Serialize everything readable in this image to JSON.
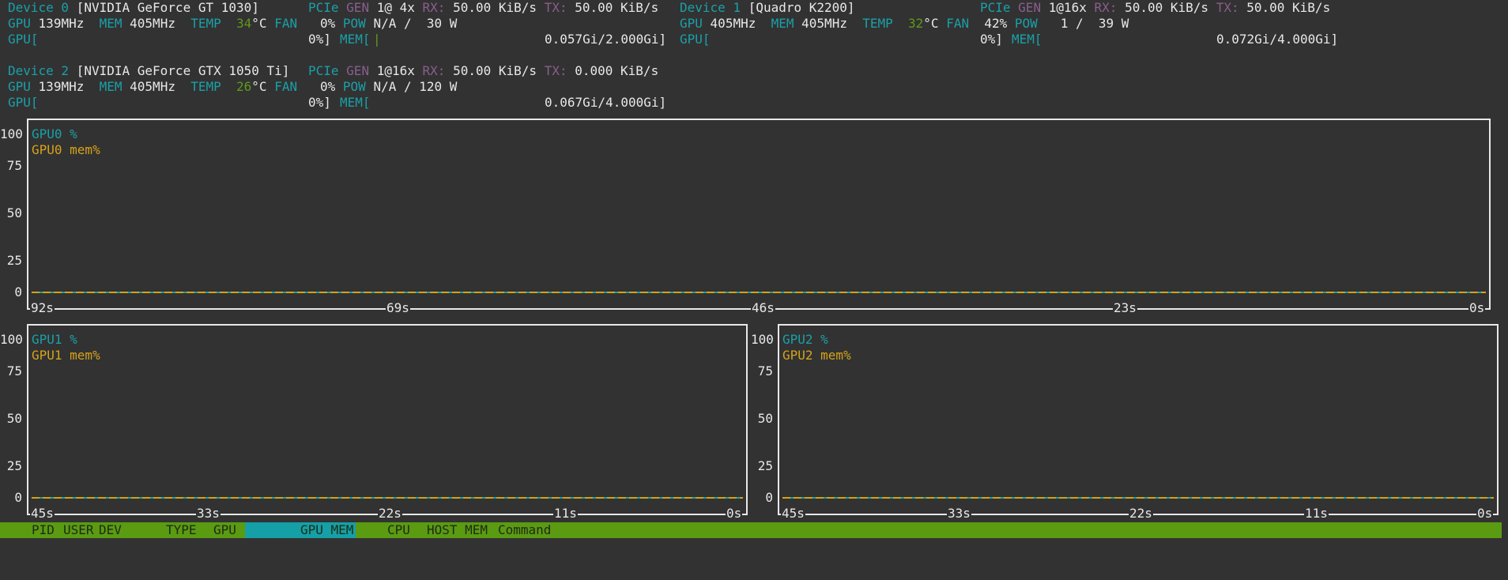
{
  "devices": [
    {
      "label": "Device 0",
      "name": "[NVIDIA GeForce GT 1030]",
      "pcie_gen": "1@ 4x",
      "rx": "50.00 KiB/s",
      "tx": "50.00 KiB/s",
      "gpu_clock": "139MHz",
      "mem_clock": "405MHz",
      "temp": "34",
      "fan": "0%",
      "pow": "N/A /  30 W",
      "gpu_pct": "0%]",
      "mem_usage": "0.057Gi/2.000Gi]"
    },
    {
      "label": "Device 1",
      "name": "[Quadro K2200]",
      "pcie_gen": "1@16x",
      "rx": "50.00 KiB/s",
      "tx": "50.00 KiB/s",
      "gpu_clock": "405MHz",
      "mem_clock": "405MHz",
      "temp": "32",
      "fan": "42%",
      "pow": "1 /  39 W",
      "gpu_pct": "0%]",
      "mem_usage": "0.072Gi/4.000Gi]"
    },
    {
      "label": "Device 2",
      "name": "[NVIDIA GeForce GTX 1050 Ti]",
      "pcie_gen": "1@16x",
      "rx": "50.00 KiB/s",
      "tx": "0.000 KiB/s",
      "gpu_clock": "139MHz",
      "mem_clock": "405MHz",
      "temp": "26",
      "fan": "0%",
      "pow": "N/A / 120 W",
      "gpu_pct": "0%]",
      "mem_usage": "0.067Gi/4.000Gi]"
    }
  ],
  "labels": {
    "pcie": "PCIe",
    "gen": "GEN",
    "rx": "RX:",
    "tx": "TX:",
    "gpu": "GPU",
    "mem": "MEM",
    "temp": "TEMP",
    "deg": "°C",
    "fan": "FAN",
    "pow": "POW",
    "gpu_bar": "GPU[",
    "mem_bar": "MEM["
  },
  "charts": [
    {
      "series": [
        "GPU0 %",
        "GPU0 mem%"
      ],
      "yticks": [
        "100",
        "75",
        "50",
        "25",
        "0"
      ],
      "xticks": [
        "92s",
        "69s",
        "46s",
        "23s",
        "0s"
      ]
    },
    {
      "series": [
        "GPU1 %",
        "GPU1 mem%"
      ],
      "yticks": [
        "100",
        "75",
        "50",
        "25",
        "0"
      ],
      "xticks": [
        "45s",
        "33s",
        "22s",
        "11s",
        "0s"
      ]
    },
    {
      "series": [
        "GPU2 %",
        "GPU2 mem%"
      ],
      "yticks": [
        "100",
        "75",
        "50",
        "25",
        "0"
      ],
      "xticks": [
        "45s",
        "33s",
        "22s",
        "11s",
        "0s"
      ]
    }
  ],
  "process_header": {
    "pid": "PID",
    "user": "USER",
    "dev": "DEV",
    "type": "TYPE",
    "gpu": "GPU",
    "gpu_mem": "GPU MEM",
    "cpu": "CPU",
    "host_mem": "HOST MEM",
    "command": "Command",
    "sorted_by": "GPU MEM"
  },
  "colors": {
    "background": "#323232",
    "teal": "#1aa0a8",
    "purple": "#8a5e8e",
    "green_header": "#5a9b12",
    "gold": "#d6a21a"
  }
}
